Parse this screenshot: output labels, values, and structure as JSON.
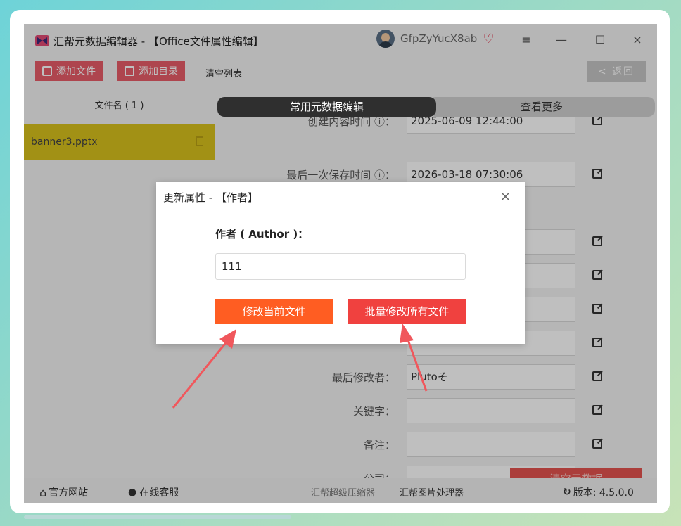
{
  "window": {
    "title": "汇帮元数据编辑器 - 【Office文件属性编辑】",
    "username": "GfpZyYucX8ab",
    "controls": {
      "menu": "≡",
      "minimize": "—",
      "maximize": "☐",
      "close": "×"
    }
  },
  "toolbar": {
    "add_file": "添加文件",
    "add_dir": "添加目录",
    "clear_list": "清空列表",
    "back": "< 返回"
  },
  "sidebar": {
    "header": "文件名 ( 1 )",
    "files": [
      {
        "name": "banner3.pptx"
      }
    ]
  },
  "tabs": {
    "active": "常用元数据编辑",
    "inactive": "查看更多"
  },
  "fields": {
    "created_partial": {
      "label": "创建内容时间 ⓘ：",
      "value": "2025-06-09 12:44:00"
    },
    "last_saved": {
      "label": "最后一次保存时间 ⓘ：",
      "value": "2026-03-18 07:30:06"
    },
    "last_modified_by": {
      "label": "最后修改者：",
      "value": "Plutoそ"
    },
    "keywords": {
      "label": "关键字：",
      "value": ""
    },
    "notes": {
      "label": "备注：",
      "value": ""
    },
    "company": {
      "label": "公司：",
      "value": ""
    }
  },
  "clear_metadata": "清空元数据",
  "statusbar": {
    "website": "官方网站",
    "support": "在线客服",
    "compressor": "汇帮超级压缩器",
    "image_tool": "汇帮图片处理器",
    "version": "版本: 4.5.0.0"
  },
  "modal": {
    "title": "更新属性 - 【作者】",
    "close": "×",
    "field_label": "作者 ( Author )：",
    "field_value": "111",
    "btn_current": "修改当前文件",
    "btn_all": "批量修改所有文件"
  },
  "colors": {
    "accent_red": "#e85c68",
    "selected_file": "#d9c21d",
    "modal_btn_current": "#ff5d22",
    "modal_btn_all": "#f0413f"
  }
}
